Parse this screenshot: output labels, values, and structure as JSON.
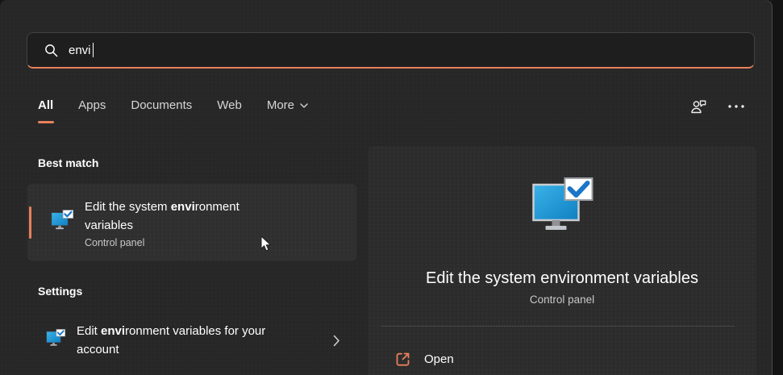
{
  "colors": {
    "accent": "#E8805C",
    "app_icon_blue": "#1E9CD7",
    "check_blue": "#1B76C8"
  },
  "search": {
    "value": "envi",
    "icon": "magnifier-search-icon"
  },
  "tabs": {
    "selected_index": 0,
    "items": [
      {
        "label": "All"
      },
      {
        "label": "Apps"
      },
      {
        "label": "Documents"
      },
      {
        "label": "Web"
      },
      {
        "label": "More"
      }
    ]
  },
  "topbar": {
    "feedback_icon": "person-with-chat-bubble",
    "more_options_icon": "ellipsis"
  },
  "sections": {
    "best_match": {
      "heading": "Best match",
      "item": {
        "title_prefix": "Edit the system ",
        "title_match": "envi",
        "title_suffix": "ronment variables",
        "subtitle": "Control panel",
        "icon": "monitor-with-checkmark"
      }
    },
    "settings": {
      "heading": "Settings",
      "item": {
        "title_prefix": "Edit ",
        "title_match": "envi",
        "title_suffix": "ronment variables for your account",
        "icon": "monitor-with-checkmark",
        "chevron_icon": "chevron-right"
      }
    }
  },
  "preview": {
    "icon": "monitor-with-checkmark-large",
    "title": "Edit the system environment variables",
    "subtitle": "Control panel",
    "actions": [
      {
        "label": "Open",
        "icon": "open-external-link"
      }
    ]
  }
}
